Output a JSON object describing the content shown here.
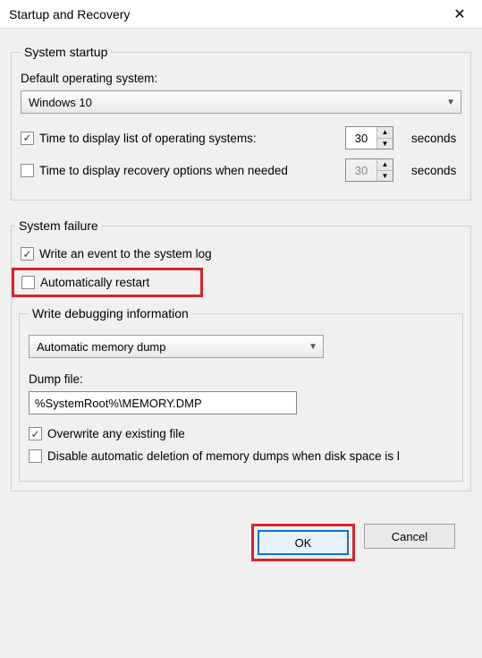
{
  "window": {
    "title": "Startup and Recovery"
  },
  "startup": {
    "legend": "System startup",
    "default_os_label": "Default operating system:",
    "default_os_value": "Windows 10",
    "display_list": {
      "label": "Time to display list of operating systems:",
      "value": "30",
      "unit": "seconds",
      "checked": true
    },
    "display_recovery": {
      "label": "Time to display recovery options when needed",
      "value": "30",
      "unit": "seconds",
      "checked": false
    }
  },
  "failure": {
    "legend": "System failure",
    "write_event": {
      "label": "Write an event to the system log",
      "checked": true
    },
    "auto_restart": {
      "label": "Automatically restart",
      "checked": false
    },
    "debug": {
      "legend": "Write debugging information",
      "type_value": "Automatic memory dump",
      "dump_file_label": "Dump file:",
      "dump_file_value": "%SystemRoot%\\MEMORY.DMP",
      "overwrite": {
        "label": "Overwrite any existing file",
        "checked": true
      },
      "disable_delete": {
        "label": "Disable automatic deletion of memory dumps when disk space is l",
        "checked": false
      }
    }
  },
  "buttons": {
    "ok": "OK",
    "cancel": "Cancel"
  }
}
